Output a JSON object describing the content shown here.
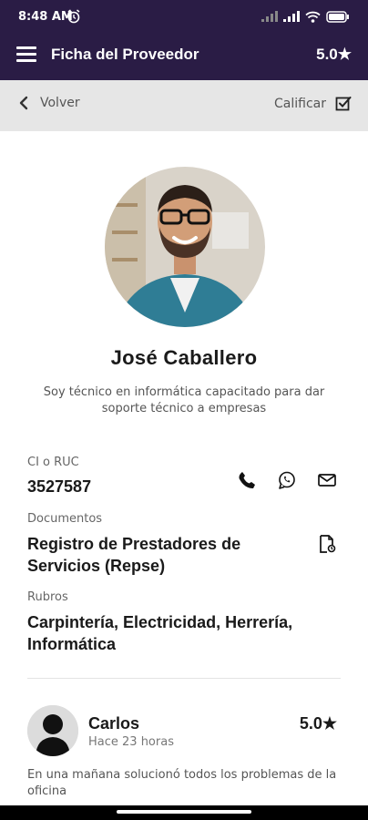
{
  "status_bar": {
    "time": "8:48 AM"
  },
  "app_bar": {
    "title": "Ficha del Proveedor",
    "rating": "5.0★"
  },
  "sub_bar": {
    "back_label": "Volver",
    "rate_label": "Calificar"
  },
  "profile": {
    "name": "José Caballero",
    "bio": "Soy técnico en informática capacitado para dar soporte técnico a empresas"
  },
  "fields": {
    "ci_label": "CI o RUC",
    "ci_value": "3527587",
    "docs_label": "Documentos",
    "docs_value": "Registro de Prestadores de Servicios (Repse)",
    "rubros_label": "Rubros",
    "rubros_value": "Carpintería, Electricidad, Herrería, Informática"
  },
  "review": {
    "name": "Carlos",
    "time": "Hace 23 horas",
    "rating": "5.0★",
    "text": "En una mañana solucionó todos los problemas de la oficina"
  },
  "icons": [
    "alarm-icon",
    "signal-icon",
    "wifi-icon",
    "battery-icon",
    "menu-icon",
    "back-arrow-icon",
    "checkbox-icon",
    "phone-icon",
    "whatsapp-icon",
    "mail-icon",
    "document-icon"
  ],
  "colors": {
    "header": "#2a1c45",
    "subbar": "#e6e6e6"
  }
}
